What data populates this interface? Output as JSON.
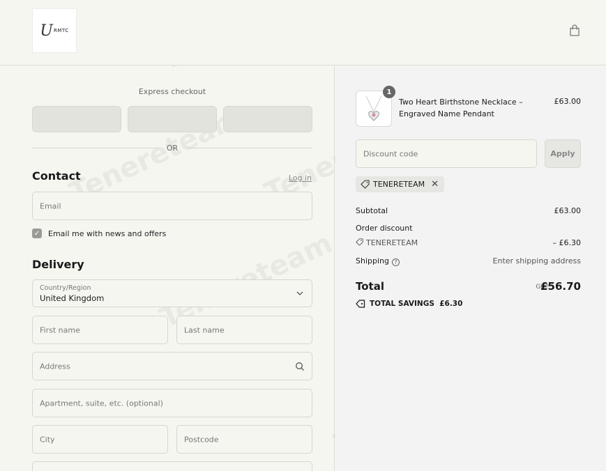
{
  "header": {
    "logo_text": "U",
    "logo_small": "RMTC"
  },
  "express": {
    "label": "Express checkout",
    "or": "OR"
  },
  "contact": {
    "title": "Contact",
    "login": "Log in",
    "email_placeholder": "Email",
    "newsletter_label": "Email me with news and offers",
    "newsletter_checked": true
  },
  "delivery": {
    "title": "Delivery",
    "country_label": "Country/Region",
    "country_value": "United Kingdom",
    "first_name": "First name",
    "last_name": "Last name",
    "address": "Address",
    "apartment": "Apartment, suite, etc. (optional)",
    "city": "City",
    "postcode": "Postcode"
  },
  "summary": {
    "product_name": "Two Heart Birthstone Necklace – Engraved Name Pendant",
    "product_price": "£63.00",
    "quantity": "1",
    "discount_placeholder": "Discount code",
    "apply": "Apply",
    "applied_code": "TENERETEAM",
    "subtotal_label": "Subtotal",
    "subtotal_value": "£63.00",
    "order_discount_label": "Order discount",
    "discount_code_label": "TENERETEAM",
    "discount_value": "– £6.30",
    "shipping_label": "Shipping",
    "shipping_value": "Enter shipping address",
    "total_label": "Total",
    "currency": "GBP",
    "total_value": "£56.70",
    "savings_label": "TOTAL SAVINGS",
    "savings_value": "£6.30"
  },
  "watermark": "Tenereteam",
  "colors": {
    "background": "#f6f6f1",
    "summary_bg": "#f3f3f3",
    "border": "#d6d6d0"
  }
}
